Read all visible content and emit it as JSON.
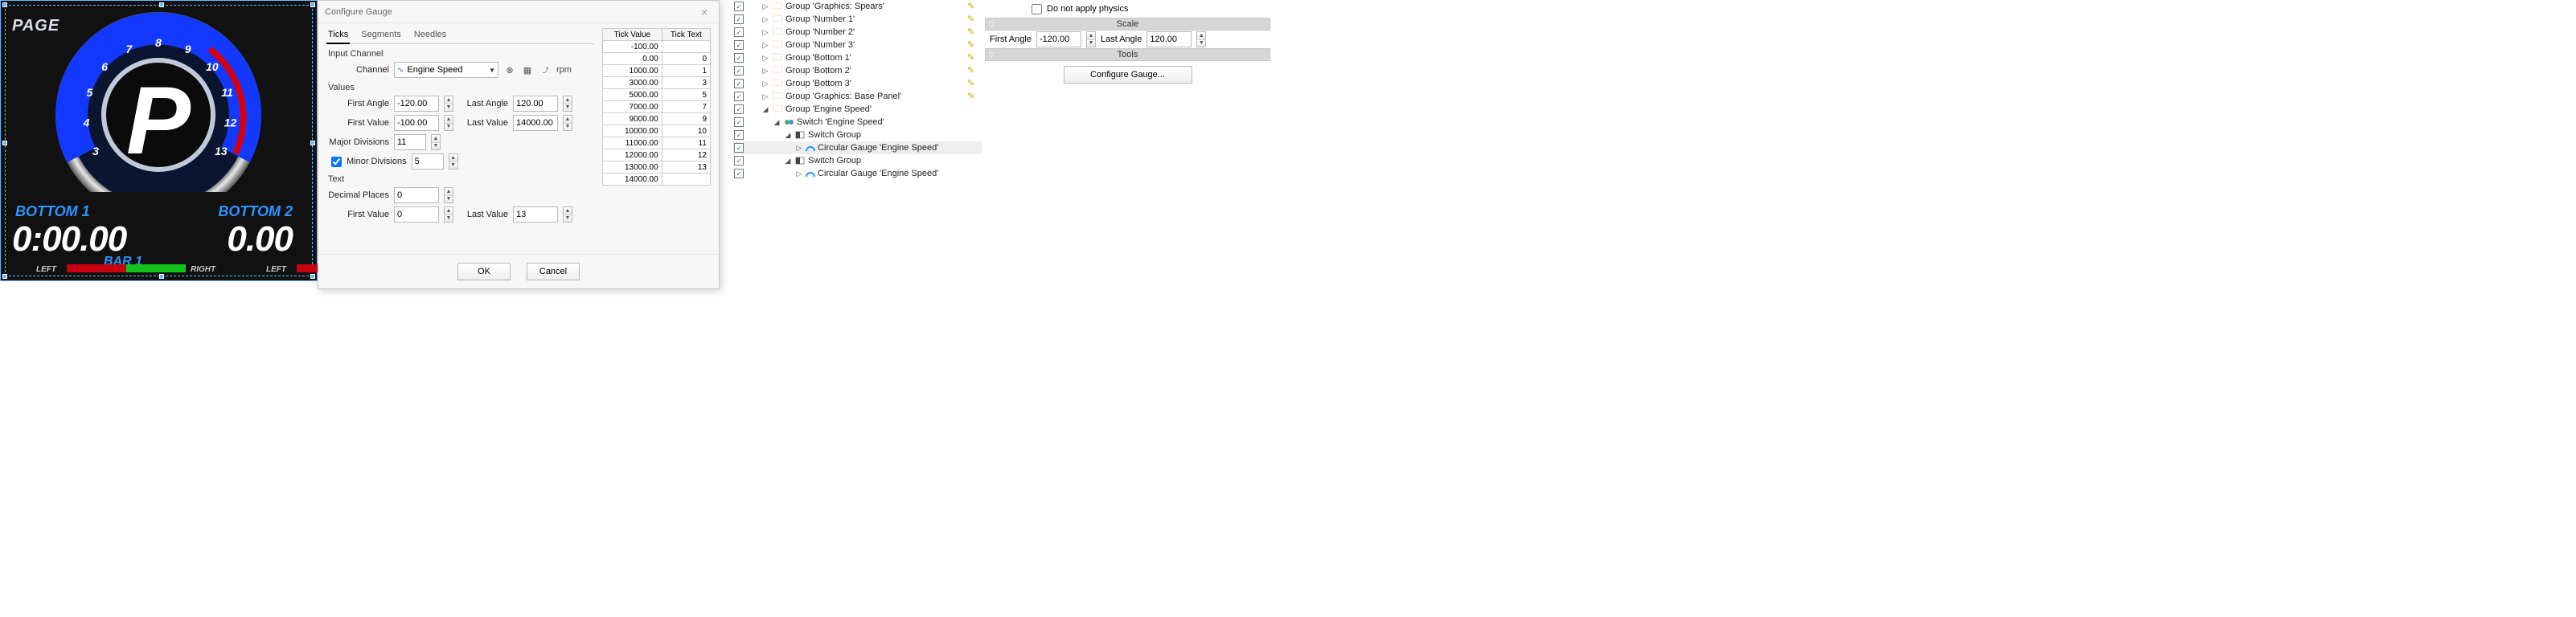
{
  "preview": {
    "page_label": "PAGE",
    "gauge_numbers": [
      "3",
      "4",
      "5",
      "6",
      "7",
      "8",
      "9",
      "10",
      "11",
      "12",
      "13"
    ],
    "center_letter": "P",
    "bottom1_label": "BOTTOM 1",
    "bottom2_label": "BOTTOM 2",
    "time1": "0:00.00",
    "time2": "0.00",
    "bar1_label": "BAR 1",
    "left_label": "LEFT",
    "right_label": "RIGHT",
    "left_label2": "LEFT"
  },
  "dialog": {
    "title": "Configure Gauge",
    "tabs": [
      "Ticks",
      "Segments",
      "Needles"
    ],
    "active_tab": 0,
    "input_channel_section": "Input Channel",
    "channel_label": "Channel",
    "channel_value": "Engine Speed",
    "channel_unit": "rpm",
    "values_section": "Values",
    "first_angle_label": "First Angle",
    "first_angle_value": "-120.00",
    "last_angle_label": "Last Angle",
    "last_angle_value": "120.00",
    "first_value_label": "First Value",
    "first_value_value": "-100.00",
    "last_value_label": "Last Value",
    "last_value_value": "14000.00",
    "major_div_label": "Major Divisions",
    "major_div_value": "11",
    "minor_div_label": "Minor Divisions",
    "minor_div_value": "5",
    "minor_div_checked": true,
    "text_section": "Text",
    "decimal_places_label": "Decimal Places",
    "decimal_places_value": "0",
    "text_first_value_label": "First Value",
    "text_first_value_value": "0",
    "text_last_value_label": "Last Value",
    "text_last_value_value": "13",
    "tick_header_value": "Tick Value",
    "tick_header_text": "Tick Text",
    "tick_rows": [
      {
        "v": "-100.00",
        "t": ""
      },
      {
        "v": "0.00",
        "t": "0"
      },
      {
        "v": "1000.00",
        "t": "1"
      },
      {
        "v": "3000.00",
        "t": "3"
      },
      {
        "v": "5000.00",
        "t": "5"
      },
      {
        "v": "7000.00",
        "t": "7"
      },
      {
        "v": "9000.00",
        "t": "9"
      },
      {
        "v": "10000.00",
        "t": "10"
      },
      {
        "v": "11000.00",
        "t": "11"
      },
      {
        "v": "12000.00",
        "t": "12"
      },
      {
        "v": "13000.00",
        "t": "13"
      },
      {
        "v": "14000.00",
        "t": ""
      }
    ],
    "ok_label": "OK",
    "cancel_label": "Cancel"
  },
  "tree": {
    "items": [
      {
        "depth": 0,
        "exp": "▷",
        "type": "folder",
        "label": "Group 'Graphics: Spears'",
        "edit": true
      },
      {
        "depth": 0,
        "exp": "▷",
        "type": "folder",
        "label": "Group 'Number 1'",
        "edit": true
      },
      {
        "depth": 0,
        "exp": "▷",
        "type": "folder",
        "label": "Group 'Number 2'",
        "edit": true
      },
      {
        "depth": 0,
        "exp": "▷",
        "type": "folder",
        "label": "Group 'Number 3'",
        "edit": true
      },
      {
        "depth": 0,
        "exp": "▷",
        "type": "folder",
        "label": "Group 'Bottom 1'",
        "edit": true
      },
      {
        "depth": 0,
        "exp": "▷",
        "type": "folder",
        "label": "Group 'Bottom 2'",
        "edit": true
      },
      {
        "depth": 0,
        "exp": "▷",
        "type": "folder",
        "label": "Group 'Bottom 3'",
        "edit": true
      },
      {
        "depth": 0,
        "exp": "▷",
        "type": "folder",
        "label": "Group 'Graphics: Base Panel'",
        "edit": true
      },
      {
        "depth": 0,
        "exp": "◢",
        "type": "folder",
        "label": "Group 'Engine Speed'",
        "edit": false
      },
      {
        "depth": 1,
        "exp": "◢",
        "type": "switch",
        "label": "Switch 'Engine Speed'",
        "edit": false
      },
      {
        "depth": 2,
        "exp": "◢",
        "type": "switchgroup",
        "label": "Switch Group",
        "edit": false
      },
      {
        "depth": 3,
        "exp": "▷",
        "type": "gauge",
        "label": "Circular Gauge 'Engine Speed'",
        "edit": false,
        "selected": true
      },
      {
        "depth": 2,
        "exp": "◢",
        "type": "switchgroup",
        "label": "Switch Group",
        "edit": false
      },
      {
        "depth": 3,
        "exp": "▷",
        "type": "gauge",
        "label": "Circular Gauge 'Engine Speed'",
        "edit": false
      }
    ]
  },
  "props": {
    "physics_label": "Do not apply physics",
    "scale_header": "Scale",
    "first_angle_label": "First Angle",
    "first_angle_value": "-120.00",
    "last_angle_label": "Last Angle",
    "last_angle_value": "120.00",
    "tools_header": "Tools",
    "configure_button": "Configure Gauge..."
  }
}
